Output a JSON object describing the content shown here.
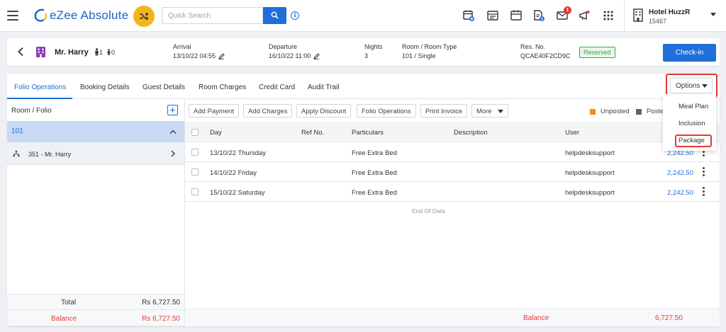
{
  "app": {
    "name": "eZee Absolute"
  },
  "search": {
    "placeholder": "Quick Search"
  },
  "header_icons": [
    "calendar-add-icon",
    "tape-chart-icon",
    "calendar-icon",
    "report-icon",
    "mail-icon",
    "announcement-icon",
    "apps-grid-icon"
  ],
  "notifications": {
    "mail_count": "1"
  },
  "hotel": {
    "name": "Hotel HuzzR",
    "code": "15467"
  },
  "reservation": {
    "guest_name": "Mr. Harry",
    "adults": "1",
    "children": "0",
    "arrival_label": "Arrival",
    "arrival_value": "13/10/22 04:55",
    "departure_label": "Departure",
    "departure_value": "16/10/22 11:00",
    "nights_label": "Nights",
    "nights_value": "3",
    "room_type_label": "Room / Room Type",
    "room_type_value": "101 / Single",
    "res_no_label": "Res. No.",
    "res_no_value": "QCAE40F2CD9C",
    "status": "Reserved",
    "checkin_label": "Check-in"
  },
  "tabs": [
    "Folio Operations",
    "Booking Details",
    "Guest Details",
    "Room Charges",
    "Credit Card",
    "Audit Trail"
  ],
  "options": {
    "label": "Options",
    "menu": [
      "Meal Plan",
      "Inclusion",
      "Package"
    ]
  },
  "folio_panel": {
    "title": "Room / Folio",
    "room": "101",
    "folio": "351 - Mr. Harry",
    "total_label": "Total",
    "total_value": "Rs 6,727.50",
    "balance_label": "Balance",
    "balance_value": "Rs 6,727.50"
  },
  "toolbar": {
    "buttons": [
      "Add Payment",
      "Add Charges",
      "Apply Discount",
      "Folio Operations",
      "Print Invoice",
      "More"
    ]
  },
  "legend": {
    "unposted": "Unposted",
    "posted": "Posted",
    "unposted_color": "#f0900c",
    "posted_color": "#5a6475"
  },
  "grid": {
    "columns": [
      "Day",
      "Ref No.",
      "Particulars",
      "Description",
      "User"
    ],
    "rows": [
      {
        "day": "13/10/22 Thursday",
        "ref": "",
        "particulars": "Free Extra Bed",
        "description": "",
        "user": "helpdesksupport",
        "amount": "2,242.50"
      },
      {
        "day": "14/10/22 Friday",
        "ref": "",
        "particulars": "Free Extra Bed",
        "description": "",
        "user": "helpdesksupport",
        "amount": "2,242.50"
      },
      {
        "day": "15/10/22 Saturday",
        "ref": "",
        "particulars": "Free Extra Bed",
        "description": "",
        "user": "helpdesksupport",
        "amount": "2,242.50"
      }
    ],
    "end_text": "End Of Data",
    "balance_label": "Balance",
    "balance_value": "6,727.50"
  },
  "colors": {
    "accent": "#1e6fd9",
    "highlight": "#e53935",
    "selected_row": "#c9d9f3",
    "reserved": "#3aa74a"
  }
}
